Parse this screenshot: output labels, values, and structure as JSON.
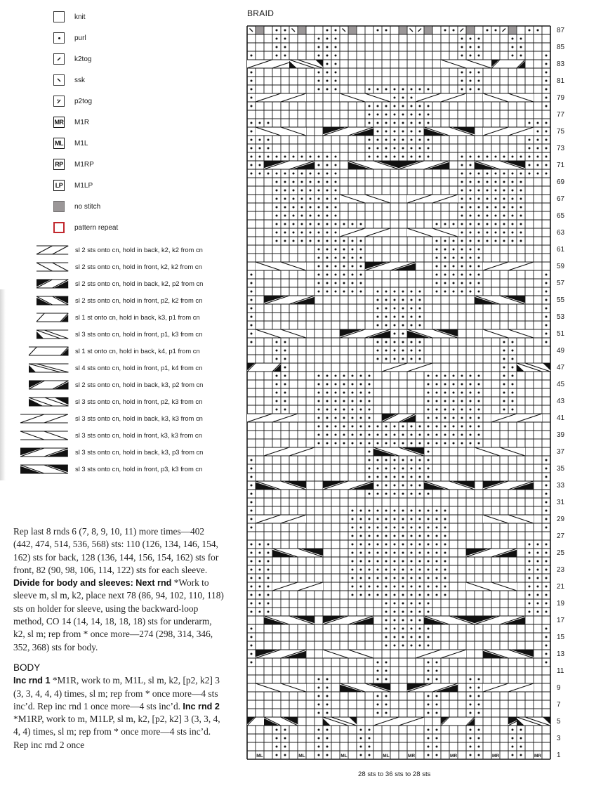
{
  "legend_simple": [
    {
      "symbol": "knit",
      "label": "knit"
    },
    {
      "symbol": "purl",
      "label": "purl"
    },
    {
      "symbol": "k2tog",
      "label": "k2tog"
    },
    {
      "symbol": "ssk",
      "label": "ssk"
    },
    {
      "symbol": "p2tog",
      "label": "p2tog"
    },
    {
      "symbol": "MR",
      "label": "M1R"
    },
    {
      "symbol": "ML",
      "label": "M1L"
    },
    {
      "symbol": "RP",
      "label": "M1RP"
    },
    {
      "symbol": "LP",
      "label": "M1LP"
    },
    {
      "symbol": "no-stitch",
      "label": "no stitch"
    },
    {
      "symbol": "repeat",
      "label": "pattern repeat"
    }
  ],
  "legend_cables": [
    {
      "a": 2,
      "b": 2,
      "dir": "back",
      "fillA": false,
      "fillB": false,
      "label": "sl 2 sts onto cn, hold in back, k2, k2 from cn"
    },
    {
      "a": 2,
      "b": 2,
      "dir": "front",
      "fillA": false,
      "fillB": false,
      "label": "sl 2 sts onto cn, hold in front, k2, k2 from cn"
    },
    {
      "a": 2,
      "b": 2,
      "dir": "back",
      "fillA": true,
      "fillB": true,
      "label": "sl 2 sts onto cn, hold in back, k2, p2 from cn"
    },
    {
      "a": 2,
      "b": 2,
      "dir": "front",
      "fillA": true,
      "fillB": true,
      "label": "sl 2 sts onto cn, hold in front, p2, k2 from cn"
    },
    {
      "a": 3,
      "b": 1,
      "dir": "back",
      "fillA": false,
      "fillB": true,
      "label": "sl 1 st onto cn, hold in back, k3, p1 from cn"
    },
    {
      "a": 1,
      "b": 3,
      "dir": "front",
      "fillA": true,
      "fillB": false,
      "label": "sl 3 sts onto cn, hold in front, p1, k3 from cn"
    },
    {
      "a": 4,
      "b": 1,
      "dir": "back",
      "fillA": false,
      "fillB": true,
      "label": "sl 1 st onto cn, hold in back, k4, p1 from cn"
    },
    {
      "a": 1,
      "b": 4,
      "dir": "front",
      "fillA": true,
      "fillB": false,
      "label": "sl 4 sts onto cn, hold in front, p1, k4 from cn"
    },
    {
      "a": 3,
      "b": 2,
      "dir": "back",
      "fillA": true,
      "fillB": true,
      "label": "sl 2 sts onto cn, hold in back, k3, p2 from cn"
    },
    {
      "a": 2,
      "b": 3,
      "dir": "front",
      "fillA": true,
      "fillB": true,
      "label": "sl 3 sts onto cn, hold in front, p2, k3 from cn"
    },
    {
      "a": 3,
      "b": 3,
      "dir": "back",
      "fillA": false,
      "fillB": false,
      "label": "sl 3 sts onto cn, hold in back, k3, k3 from cn"
    },
    {
      "a": 3,
      "b": 3,
      "dir": "front",
      "fillA": false,
      "fillB": false,
      "label": "sl 3 sts onto cn, hold in front, k3, k3 from cn"
    },
    {
      "a": 3,
      "b": 3,
      "dir": "back",
      "fillA": true,
      "fillB": true,
      "label": "sl 3 sts onto cn, hold in back, k3, p3 from cn"
    },
    {
      "a": 3,
      "b": 3,
      "dir": "front",
      "fillA": true,
      "fillB": true,
      "label": "sl 3 sts onto cn, hold in front, p3, k3 from cn"
    }
  ],
  "instructions": {
    "para1_a": "Rep last 8 rnds 6 (7, 8, 9, 10, 11) more times—402 (442, 474, 514, 536, 568) sts: 110 (126, 134, 146, 154, 162) sts for back, 128 (136, 144, 156, 154, 162) sts for front, 82 (90, 98, 106, 114, 122) sts for each sleeve. ",
    "para1_bold": "Divide for body and sleeves: Next rnd",
    "para1_b": " *Work to sleeve m, sl m, k2, place next 78 (86, 94, 102, 110, 118) sts on holder for sleeve, using the backward-loop method, CO 14 (14, 14, 18, 18, 18) sts for underarm, k2, sl m; rep from * once more—274 (298, 314, 346, 352, 368) sts for body.",
    "body_heading": "BODY",
    "inc1_bold": "Inc rnd 1",
    "inc1_text": " *M1R, work to m, M1L, sl m, k2, [p2, k2] 3 (3, 3, 4, 4, 4) times, sl m; rep from * once more—4 sts inc’d. Rep inc rnd 1 once more—4 sts inc’d. ",
    "inc2_bold": "Inc rnd 2",
    "inc2_text": " *M1RP, work to m, M1LP, sl m, k2, [p2, k2] 3 (3, 3, 4, 4, 4) times, sl m; rep from * once more—4 sts inc’d. Rep inc rnd 2 once"
  },
  "chart": {
    "title": "BRAID",
    "caption": "28 sts to 36 sts to 28 sts",
    "columns": 36,
    "rows": 87,
    "row_labels": [
      87,
      85,
      83,
      81,
      79,
      77,
      75,
      73,
      71,
      69,
      67,
      65,
      63,
      61,
      59,
      57,
      55,
      53,
      51,
      49,
      47,
      45,
      43,
      41,
      39,
      37,
      35,
      33,
      31,
      29,
      27,
      25,
      23,
      21,
      19,
      17,
      15,
      13,
      11,
      9,
      7,
      5,
      3,
      1
    ],
    "colors": {
      "line": "#1a1a1a",
      "no_stitch": "#9b9798",
      "repeat": "#c1272d"
    },
    "bottom_row": [
      "",
      "ML",
      "",
      "P",
      "P",
      "",
      "ML",
      "",
      "P",
      "P",
      "",
      "ML",
      "",
      "P",
      "P",
      "",
      "ML",
      "",
      "",
      "MR",
      "",
      "P",
      "P",
      "",
      "MR",
      "",
      "P",
      "P",
      "",
      "MR",
      "",
      "P",
      "P",
      "",
      "MR",
      ""
    ],
    "top_row": [
      "SSK",
      "NS",
      "",
      "P",
      "P",
      "SSK",
      "NS",
      "",
      "",
      "P",
      "P",
      "SSK",
      "NS",
      "",
      "",
      "P",
      "P",
      "",
      "NS",
      "SSK",
      "K2T",
      "NS",
      "",
      "P",
      "P",
      "K2T",
      "NS",
      "",
      "P",
      "P",
      "K2T",
      "NS",
      "",
      "P",
      "P",
      ""
    ],
    "purl_blocks": [
      {
        "rows": [
          2,
          4
        ],
        "cols": [
          4,
          5
        ]
      },
      {
        "rows": [
          2,
          4
        ],
        "cols": [
          9,
          10
        ]
      },
      {
        "rows": [
          2,
          4
        ],
        "cols": [
          14,
          15
        ]
      },
      {
        "rows": [
          2,
          4
        ],
        "cols": [
          22,
          23
        ]
      },
      {
        "rows": [
          2,
          4
        ],
        "cols": [
          27,
          28
        ]
      },
      {
        "rows": [
          2,
          4
        ],
        "cols": [
          32,
          33
        ]
      },
      {
        "rows": [
          6,
          10
        ],
        "cols": [
          9,
          10
        ]
      },
      {
        "rows": [
          6,
          10
        ],
        "cols": [
          27,
          28
        ]
      },
      {
        "rows": [
          6,
          12
        ],
        "cols": [
          16,
          17
        ]
      },
      {
        "rows": [
          6,
          12
        ],
        "cols": [
          22,
          23
        ]
      },
      {
        "rows": [
          12,
          16
        ],
        "cols": [
          1,
          1
        ]
      },
      {
        "rows": [
          12,
          16
        ],
        "cols": [
          36,
          36
        ]
      },
      {
        "rows": [
          14,
          20
        ],
        "cols": [
          17,
          22
        ]
      },
      {
        "rows": [
          18,
          26
        ],
        "cols": [
          1,
          3
        ]
      },
      {
        "rows": [
          18,
          26
        ],
        "cols": [
          34,
          36
        ]
      },
      {
        "rows": [
          20,
          30
        ],
        "cols": [
          13,
          24
        ]
      },
      {
        "rows": [
          28,
          36
        ],
        "cols": [
          1,
          1
        ]
      },
      {
        "rows": [
          28,
          36
        ],
        "cols": [
          36,
          36
        ]
      },
      {
        "rows": [
          32,
          40
        ],
        "cols": [
          15,
          22
        ]
      },
      {
        "rows": [
          38,
          46
        ],
        "cols": [
          9,
          15
        ]
      },
      {
        "rows": [
          38,
          46
        ],
        "cols": [
          22,
          28
        ]
      },
      {
        "rows": [
          42,
          50
        ],
        "cols": [
          4,
          5
        ]
      },
      {
        "rows": [
          42,
          50
        ],
        "cols": [
          31,
          32
        ]
      },
      {
        "rows": [
          48,
          56
        ],
        "cols": [
          16,
          21
        ]
      },
      {
        "rows": [
          50,
          58
        ],
        "cols": [
          1,
          1
        ]
      },
      {
        "rows": [
          50,
          58
        ],
        "cols": [
          36,
          36
        ]
      },
      {
        "rows": [
          56,
          64
        ],
        "cols": [
          9,
          14
        ]
      },
      {
        "rows": [
          56,
          64
        ],
        "cols": [
          23,
          28
        ]
      },
      {
        "rows": [
          62,
          72
        ],
        "cols": [
          4,
          11
        ]
      },
      {
        "rows": [
          62,
          72
        ],
        "cols": [
          26,
          33
        ]
      },
      {
        "rows": [
          70,
          76
        ],
        "cols": [
          1,
          3
        ]
      },
      {
        "rows": [
          70,
          76
        ],
        "cols": [
          34,
          36
        ]
      },
      {
        "rows": [
          72,
          80
        ],
        "cols": [
          15,
          22
        ]
      },
      {
        "rows": [
          78,
          84
        ],
        "cols": [
          1,
          1
        ]
      },
      {
        "rows": [
          78,
          84
        ],
        "cols": [
          36,
          36
        ]
      },
      {
        "rows": [
          80,
          86
        ],
        "cols": [
          9,
          11
        ]
      },
      {
        "rows": [
          80,
          86
        ],
        "cols": [
          26,
          28
        ]
      },
      {
        "rows": [
          84,
          86
        ],
        "cols": [
          4,
          5
        ]
      },
      {
        "rows": [
          84,
          86
        ],
        "cols": [
          32,
          33
        ]
      }
    ],
    "cables": [
      {
        "row": 5,
        "col": 1,
        "a": 3,
        "b": 1,
        "dir": "back",
        "fill": true
      },
      {
        "row": 5,
        "col": 3,
        "a": 2,
        "b": 2,
        "dir": "front",
        "fill": true
      },
      {
        "row": 5,
        "col": 10,
        "a": 1,
        "b": 3,
        "dir": "front",
        "fill": true
      },
      {
        "row": 5,
        "col": 16,
        "a": 3,
        "b": 3,
        "dir": "back",
        "fill": false
      },
      {
        "row": 5,
        "col": 24,
        "a": 3,
        "b": 1,
        "dir": "back",
        "fill": true
      },
      {
        "row": 5,
        "col": 32,
        "a": 2,
        "b": 2,
        "dir": "back",
        "fill": true
      },
      {
        "row": 5,
        "col": 33,
        "a": 1,
        "b": 3,
        "dir": "front",
        "fill": true
      },
      {
        "row": 9,
        "col": 2,
        "a": 3,
        "b": 3,
        "dir": "front",
        "fill": false
      },
      {
        "row": 9,
        "col": 12,
        "a": 3,
        "b": 3,
        "dir": "front",
        "fill": true
      },
      {
        "row": 9,
        "col": 20,
        "a": 3,
        "b": 3,
        "dir": "back",
        "fill": true
      },
      {
        "row": 9,
        "col": 29,
        "a": 3,
        "b": 3,
        "dir": "back",
        "fill": false
      },
      {
        "row": 13,
        "col": 2,
        "a": 3,
        "b": 3,
        "dir": "back",
        "fill": true
      },
      {
        "row": 13,
        "col": 10,
        "a": 3,
        "b": 3,
        "dir": "front",
        "fill": false
      },
      {
        "row": 13,
        "col": 21,
        "a": 3,
        "b": 3,
        "dir": "back",
        "fill": false
      },
      {
        "row": 13,
        "col": 29,
        "a": 3,
        "b": 3,
        "dir": "front",
        "fill": true
      },
      {
        "row": 17,
        "col": 3,
        "a": 3,
        "b": 3,
        "dir": "front",
        "fill": true
      },
      {
        "row": 17,
        "col": 10,
        "a": 3,
        "b": 3,
        "dir": "back",
        "fill": true
      },
      {
        "row": 17,
        "col": 22,
        "a": 3,
        "b": 3,
        "dir": "front",
        "fill": true
      },
      {
        "row": 17,
        "col": 28,
        "a": 3,
        "b": 3,
        "dir": "back",
        "fill": true
      },
      {
        "row": 21,
        "col": 4,
        "a": 3,
        "b": 3,
        "dir": "back",
        "fill": false
      },
      {
        "row": 21,
        "col": 27,
        "a": 3,
        "b": 3,
        "dir": "front",
        "fill": false
      },
      {
        "row": 25,
        "col": 4,
        "a": 3,
        "b": 3,
        "dir": "front",
        "fill": true
      },
      {
        "row": 25,
        "col": 27,
        "a": 3,
        "b": 3,
        "dir": "back",
        "fill": true
      },
      {
        "row": 29,
        "col": 2,
        "a": 3,
        "b": 3,
        "dir": "back",
        "fill": false
      },
      {
        "row": 29,
        "col": 29,
        "a": 3,
        "b": 3,
        "dir": "front",
        "fill": false
      },
      {
        "row": 33,
        "col": 2,
        "a": 3,
        "b": 3,
        "dir": "front",
        "fill": true
      },
      {
        "row": 33,
        "col": 10,
        "a": 3,
        "b": 3,
        "dir": "back",
        "fill": true
      },
      {
        "row": 33,
        "col": 22,
        "a": 3,
        "b": 3,
        "dir": "front",
        "fill": true
      },
      {
        "row": 33,
        "col": 29,
        "a": 3,
        "b": 3,
        "dir": "back",
        "fill": true
      },
      {
        "row": 37,
        "col": 3,
        "a": 3,
        "b": 3,
        "dir": "back",
        "fill": false
      },
      {
        "row": 37,
        "col": 16,
        "a": 3,
        "b": 3,
        "dir": "front",
        "fill": true
      },
      {
        "row": 37,
        "col": 28,
        "a": 3,
        "b": 3,
        "dir": "front",
        "fill": false
      },
      {
        "row": 41,
        "col": 1,
        "a": 3,
        "b": 3,
        "dir": "back",
        "fill": false
      },
      {
        "row": 41,
        "col": 17,
        "a": 2,
        "b": 2,
        "dir": "back",
        "fill": true
      },
      {
        "row": 41,
        "col": 30,
        "a": 3,
        "b": 3,
        "dir": "back",
        "fill": false
      },
      {
        "row": 47,
        "col": 1,
        "a": 3,
        "b": 1,
        "dir": "back",
        "fill": true
      },
      {
        "row": 47,
        "col": 17,
        "a": 3,
        "b": 3,
        "dir": "back",
        "fill": false
      },
      {
        "row": 47,
        "col": 33,
        "a": 1,
        "b": 3,
        "dir": "front",
        "fill": true
      },
      {
        "row": 51,
        "col": 2,
        "a": 3,
        "b": 3,
        "dir": "front",
        "fill": false
      },
      {
        "row": 51,
        "col": 12,
        "a": 3,
        "b": 3,
        "dir": "back",
        "fill": true
      },
      {
        "row": 51,
        "col": 20,
        "a": 3,
        "b": 3,
        "dir": "front",
        "fill": true
      },
      {
        "row": 51,
        "col": 29,
        "a": 3,
        "b": 3,
        "dir": "front",
        "fill": false
      },
      {
        "row": 55,
        "col": 3,
        "a": 3,
        "b": 3,
        "dir": "back",
        "fill": true
      },
      {
        "row": 55,
        "col": 28,
        "a": 3,
        "b": 3,
        "dir": "front",
        "fill": true
      },
      {
        "row": 59,
        "col": 2,
        "a": 3,
        "b": 3,
        "dir": "front",
        "fill": false
      },
      {
        "row": 59,
        "col": 15,
        "a": 3,
        "b": 3,
        "dir": "back",
        "fill": true
      },
      {
        "row": 59,
        "col": 29,
        "a": 3,
        "b": 3,
        "dir": "back",
        "fill": false
      },
      {
        "row": 63,
        "col": 12,
        "a": 3,
        "b": 3,
        "dir": "back",
        "fill": false
      },
      {
        "row": 63,
        "col": 20,
        "a": 3,
        "b": 3,
        "dir": "front",
        "fill": false
      },
      {
        "row": 67,
        "col": 12,
        "a": 3,
        "b": 3,
        "dir": "front",
        "fill": false
      },
      {
        "row": 67,
        "col": 20,
        "a": 3,
        "b": 3,
        "dir": "back",
        "fill": false
      },
      {
        "row": 71,
        "col": 3,
        "a": 3,
        "b": 3,
        "dir": "back",
        "fill": true
      },
      {
        "row": 71,
        "col": 13,
        "a": 3,
        "b": 3,
        "dir": "front",
        "fill": true
      },
      {
        "row": 71,
        "col": 19,
        "a": 3,
        "b": 3,
        "dir": "back",
        "fill": true
      },
      {
        "row": 71,
        "col": 28,
        "a": 3,
        "b": 3,
        "dir": "front",
        "fill": true
      },
      {
        "row": 75,
        "col": 2,
        "a": 3,
        "b": 3,
        "dir": "front",
        "fill": false
      },
      {
        "row": 75,
        "col": 10,
        "a": 3,
        "b": 3,
        "dir": "back",
        "fill": true
      },
      {
        "row": 75,
        "col": 22,
        "a": 3,
        "b": 3,
        "dir": "front",
        "fill": true
      },
      {
        "row": 75,
        "col": 29,
        "a": 3,
        "b": 3,
        "dir": "back",
        "fill": false
      },
      {
        "row": 79,
        "col": 2,
        "a": 3,
        "b": 3,
        "dir": "back",
        "fill": false
      },
      {
        "row": 79,
        "col": 12,
        "a": 3,
        "b": 3,
        "dir": "front",
        "fill": false
      },
      {
        "row": 79,
        "col": 21,
        "a": 3,
        "b": 3,
        "dir": "back",
        "fill": false
      },
      {
        "row": 79,
        "col": 29,
        "a": 3,
        "b": 3,
        "dir": "front",
        "fill": false
      },
      {
        "row": 83,
        "col": 1,
        "a": 3,
        "b": 3,
        "dir": "back",
        "fill": false
      },
      {
        "row": 83,
        "col": 6,
        "a": 1,
        "b": 3,
        "dir": "front",
        "fill": true
      },
      {
        "row": 83,
        "col": 24,
        "a": 3,
        "b": 3,
        "dir": "front",
        "fill": false
      },
      {
        "row": 83,
        "col": 30,
        "a": 3,
        "b": 1,
        "dir": "back",
        "fill": true
      }
    ]
  }
}
